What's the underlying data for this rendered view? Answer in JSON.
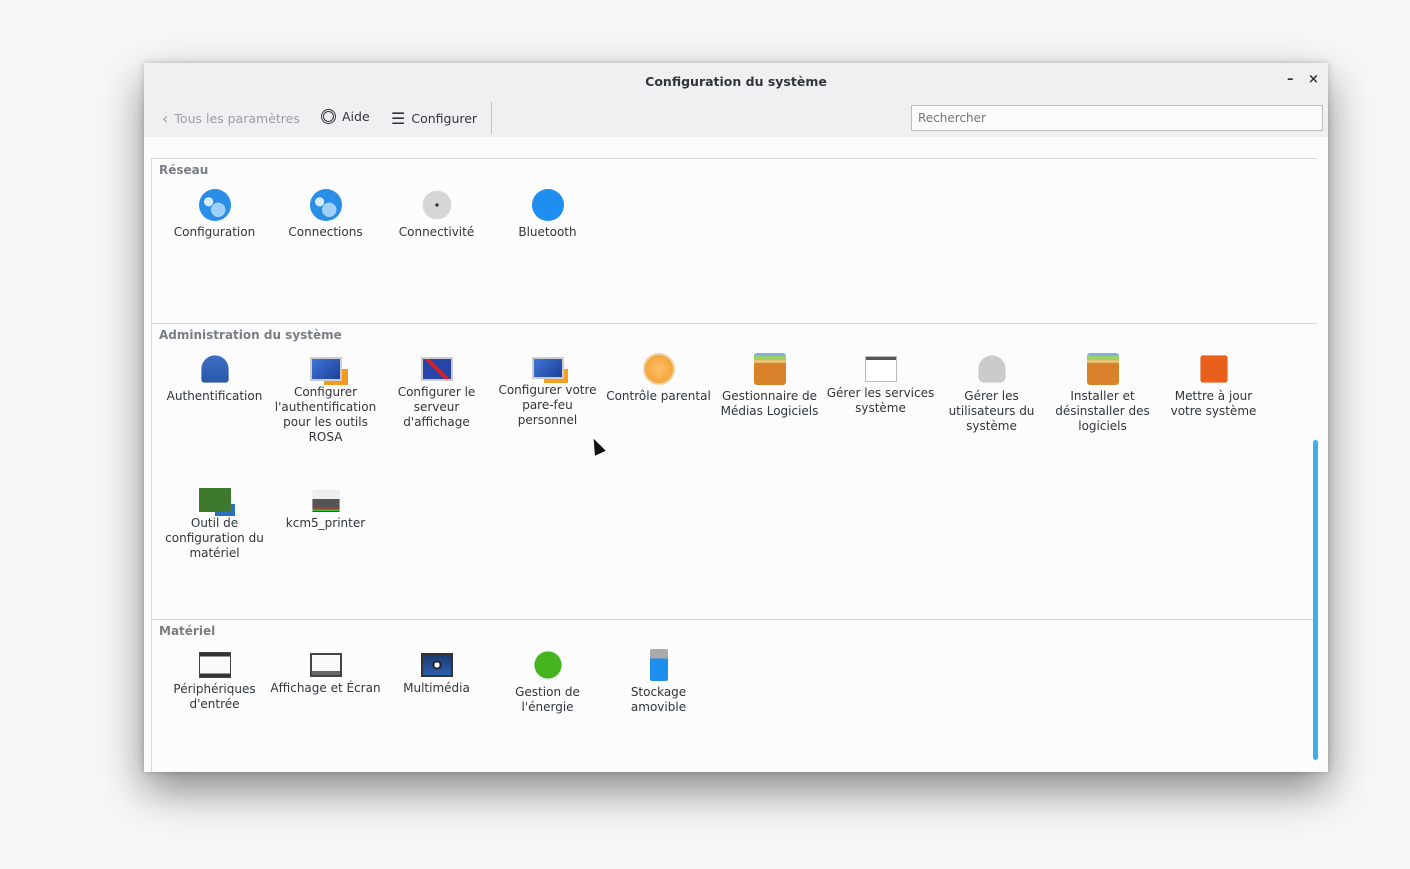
{
  "window": {
    "title": "Configuration du système",
    "minimize": "–",
    "close": "×"
  },
  "toolbar": {
    "back_label": "Tous les paramètres",
    "help_label": "Aide",
    "configure_label": "Configurer",
    "search_placeholder": "Rechercher"
  },
  "sections": [
    {
      "title": "Réseau",
      "items": [
        {
          "label": "Configuration",
          "icon": "globe-icon"
        },
        {
          "label": "Connections",
          "icon": "globe-icon"
        },
        {
          "label": "Connectivité",
          "icon": "share-icon"
        },
        {
          "label": "Bluetooth",
          "icon": "bluetooth-icon"
        }
      ]
    },
    {
      "title": "Administration du système",
      "items": [
        {
          "label": "Authentification",
          "icon": "user-key-icon"
        },
        {
          "label": "Configurer l'authentification pour les outils ROSA",
          "icon": "monitor-lock-icon"
        },
        {
          "label": "Configurer le serveur d'affichage",
          "icon": "monitor-x-icon"
        },
        {
          "label": "Configurer votre pare-feu personnel",
          "icon": "monitor-firewall-icon"
        },
        {
          "label": "Contrôle parental",
          "icon": "parental-icon"
        },
        {
          "label": "Gestionnaire de Médias Logiciels",
          "icon": "package-box-icon"
        },
        {
          "label": "Gérer les services système",
          "icon": "services-play-icon"
        },
        {
          "label": "Gérer les utilisateurs du système",
          "icon": "users-icon"
        },
        {
          "label": "Installer et désinstaller des logiciels",
          "icon": "package-box-icon"
        },
        {
          "label": "Mettre à jour votre système",
          "icon": "update-icon"
        },
        {
          "label": "Outil de configuration du matériel",
          "icon": "hardware-info-icon"
        },
        {
          "label": "kcm5_printer",
          "icon": "printer-icon"
        }
      ]
    },
    {
      "title": "Matériel",
      "items": [
        {
          "label": "Périphériques d'entrée",
          "icon": "input-devices-icon"
        },
        {
          "label": "Affichage et Écran",
          "icon": "display-icon"
        },
        {
          "label": "Multimédia",
          "icon": "multimedia-icon"
        },
        {
          "label": "Gestion de l'énergie",
          "icon": "power-icon"
        },
        {
          "label": "Stockage amovible",
          "icon": "usb-storage-icon"
        }
      ]
    }
  ]
}
